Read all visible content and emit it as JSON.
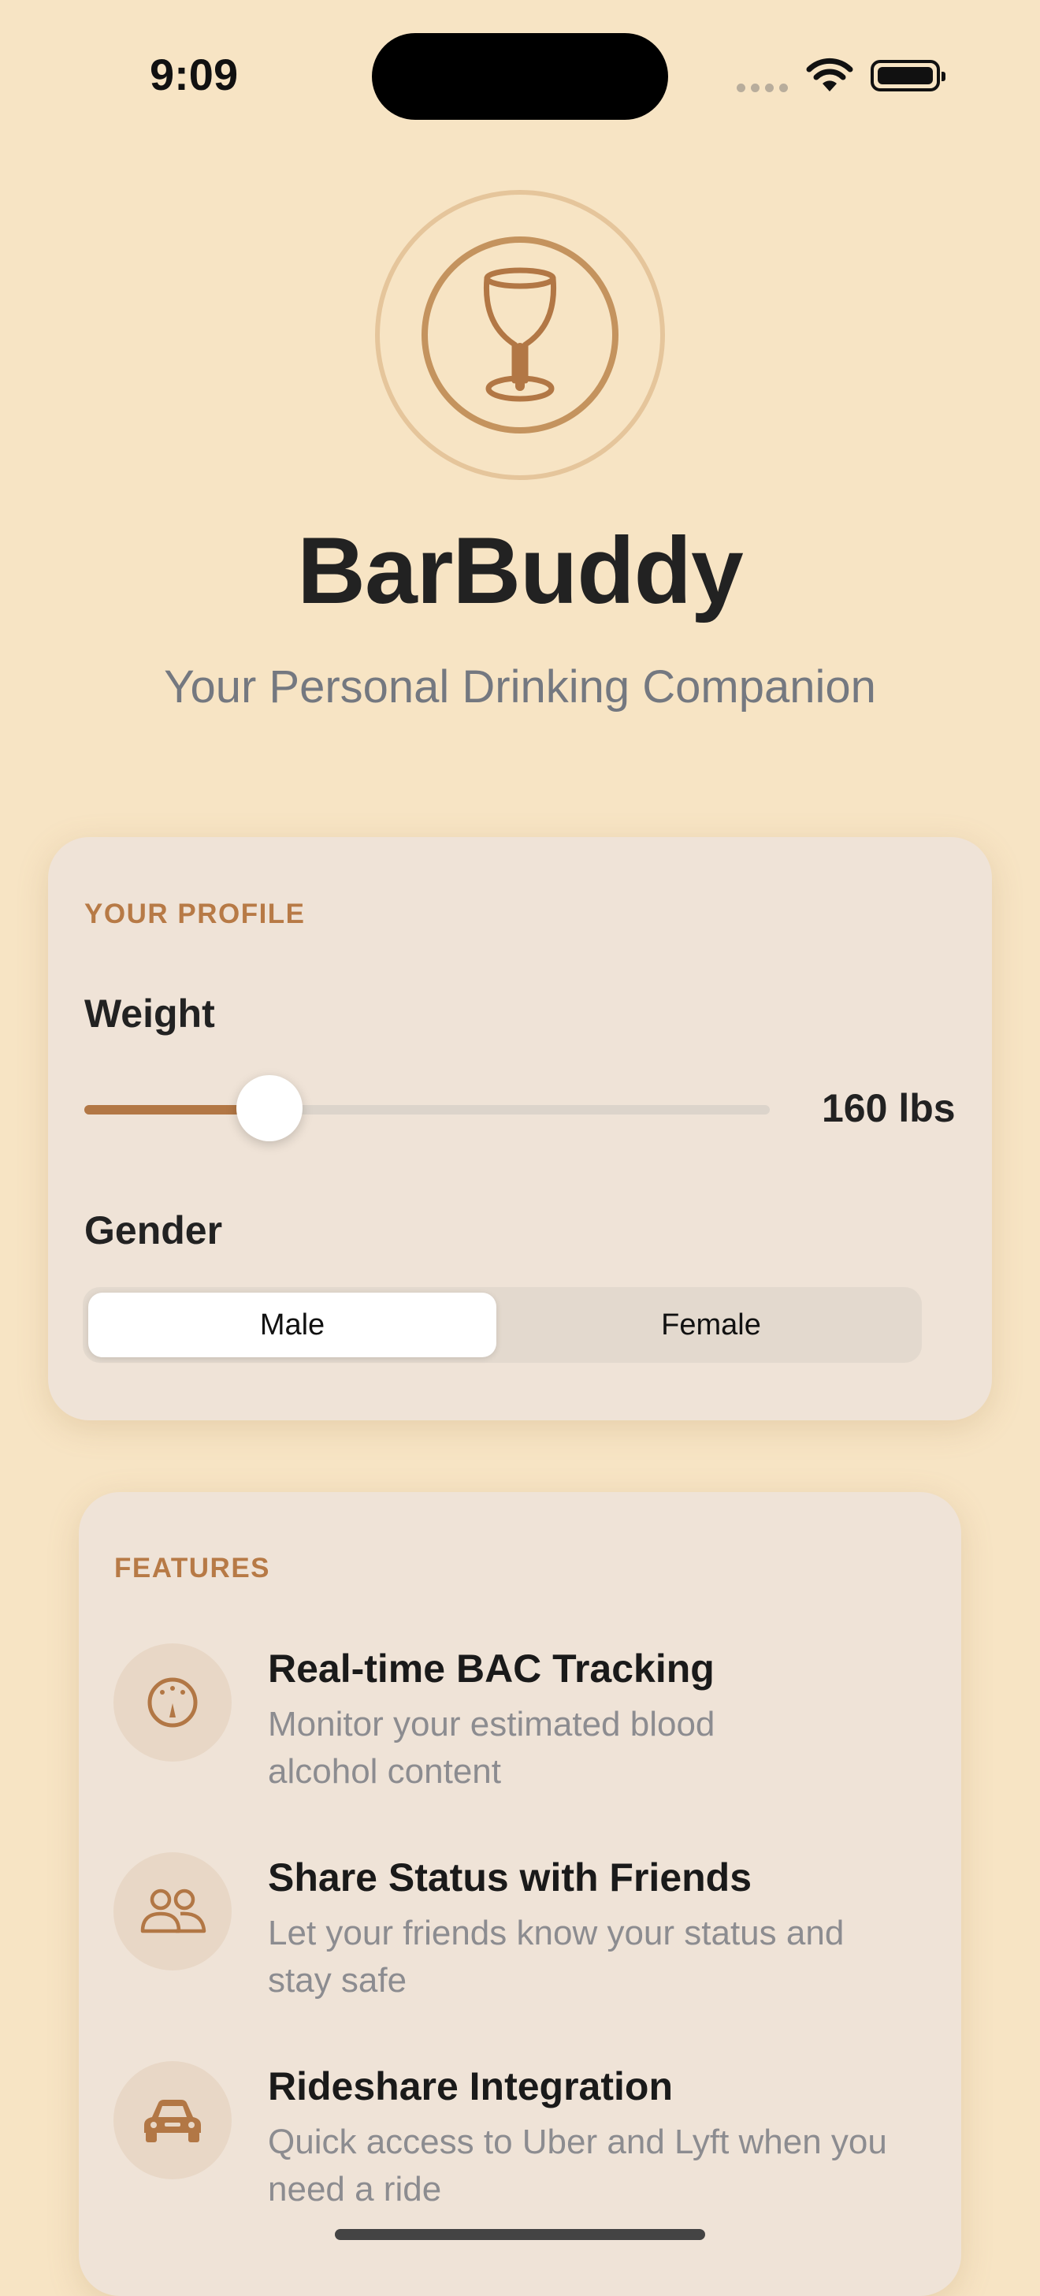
{
  "status_bar": {
    "time": "9:09"
  },
  "app": {
    "title": "BarBuddy",
    "subtitle": "Your Personal Drinking Companion"
  },
  "profile": {
    "section_label": "YOUR PROFILE",
    "weight_label": "Weight",
    "weight_value": "160 lbs",
    "weight_slider_fraction": 0.27,
    "gender_label": "Gender",
    "gender_options": [
      "Male",
      "Female"
    ],
    "gender_selected": "Male"
  },
  "features": {
    "section_label": "FEATURES",
    "items": [
      {
        "icon": "gauge-icon",
        "title": "Real-time BAC Tracking",
        "desc_line1": "Monitor your estimated blood",
        "desc_line2": "alcohol content"
      },
      {
        "icon": "people-icon",
        "title": "Share Status with Friends",
        "desc_line1": "Let your friends know your status and",
        "desc_line2": "stay safe"
      },
      {
        "icon": "car-icon",
        "title": "Rideshare Integration",
        "desc_line1": "Quick access to Uber and Lyft when you",
        "desc_line2": "need a ride"
      }
    ]
  },
  "colors": {
    "background": "#F7E4C4",
    "accent": "#B77A46",
    "card": "#EFE3D7"
  }
}
